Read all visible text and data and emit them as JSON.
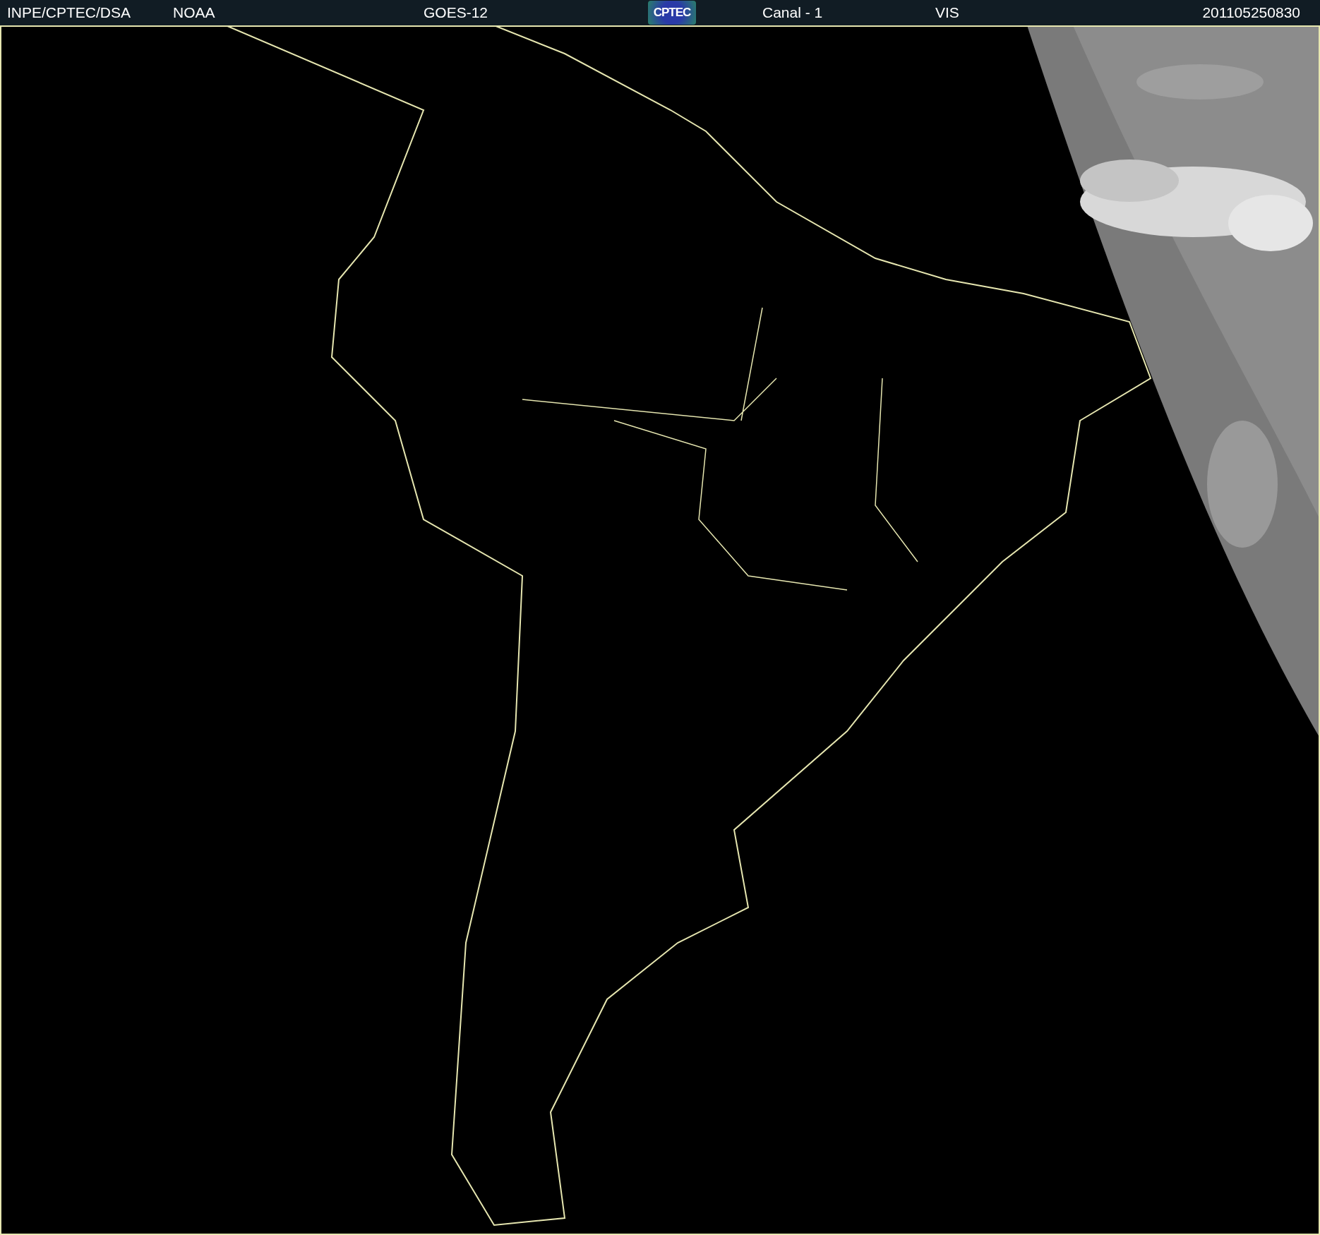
{
  "header": {
    "items": [
      {
        "kind": "text",
        "text": "INPE/CPTEC/DSA"
      },
      {
        "kind": "text",
        "text": "NOAA"
      },
      {
        "kind": "text",
        "text": "GOES-12"
      },
      {
        "kind": "logo",
        "text": "CPTEC"
      },
      {
        "kind": "text",
        "text": "Canal - 1"
      },
      {
        "kind": "text",
        "text": "VIS"
      },
      {
        "kind": "text",
        "text": "201105250830"
      }
    ]
  }
}
